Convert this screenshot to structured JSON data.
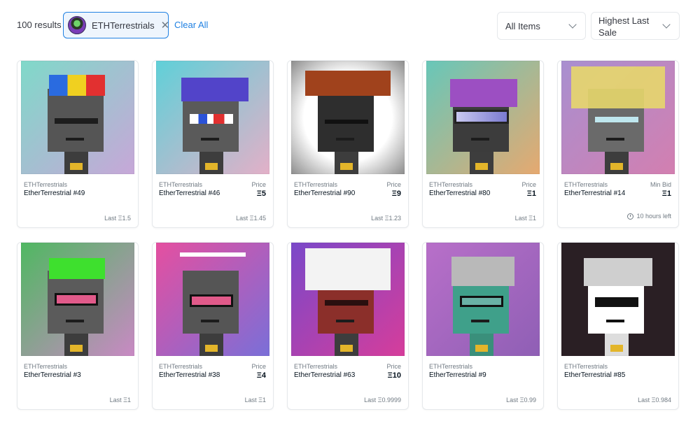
{
  "toolbar": {
    "results": "100 results",
    "filter_chip": "ETHTerrestrials",
    "clear_all": "Clear All",
    "items_dropdown": "All Items",
    "sort_dropdown": "Highest Last Sale"
  },
  "cards": [
    {
      "collection": "ETHTerrestrials",
      "name": "EtherTerrestrial #49",
      "price_label": "",
      "price": "",
      "last_sale": "Last Ξ1.5",
      "bg": "#7fd9c9",
      "bg2": "#c7a7d8",
      "hat": "propeller"
    },
    {
      "collection": "ETHTerrestrials",
      "name": "EtherTerrestrial #46",
      "price_label": "Price",
      "price": "Ξ5",
      "last_sale": "Last Ξ1.45",
      "bg": "#5fd0d8",
      "bg2": "#e3b0c8",
      "hat": "cap"
    },
    {
      "collection": "ETHTerrestrials",
      "name": "EtherTerrestrial #90",
      "price_label": "Price",
      "price": "Ξ9",
      "last_sale": "Last Ξ1.23",
      "bg": "#ffffff",
      "bg2": "#8c8c8c",
      "hat": "cowboy"
    },
    {
      "collection": "ETHTerrestrials",
      "name": "EtherTerrestrial #80",
      "price_label": "Price",
      "price": "Ξ1",
      "last_sale": "Last Ξ1",
      "bg": "#67c7b9",
      "bg2": "#e6a970",
      "hat": "visor"
    },
    {
      "collection": "ETHTerrestrials",
      "name": "EtherTerrestrial #14",
      "price_label": "Min Bid",
      "price": "Ξ1",
      "last_sale": "",
      "time_left": "10 hours left",
      "bg": "#a88fd0",
      "bg2": "#d37fb0",
      "hat": "hair"
    },
    {
      "collection": "ETHTerrestrials",
      "name": "EtherTerrestrial #3",
      "price_label": "",
      "price": "",
      "last_sale": "Last Ξ1",
      "bg": "#4fb861",
      "bg2": "#c989c4",
      "hat": "slime"
    },
    {
      "collection": "ETHTerrestrials",
      "name": "EtherTerrestrial #38",
      "price_label": "Price",
      "price": "Ξ4",
      "last_sale": "Last Ξ1",
      "bg": "#e54fa0",
      "bg2": "#7a6fd8",
      "hat": "antenna"
    },
    {
      "collection": "ETHTerrestrials",
      "name": "EtherTerrestrial #63",
      "price_label": "Price",
      "price": "Ξ10",
      "last_sale": "Last Ξ0.9999",
      "bg": "#7a48c9",
      "bg2": "#d63d9b",
      "hat": "whitehair"
    },
    {
      "collection": "ETHTerrestrials",
      "name": "EtherTerrestrial #9",
      "price_label": "",
      "price": "",
      "last_sale": "Last Ξ0.99",
      "bg": "#b86fc9",
      "bg2": "#8f5fb5",
      "hat": "helmet"
    },
    {
      "collection": "ETHTerrestrials",
      "name": "EtherTerrestrial #85",
      "price_label": "",
      "price": "",
      "last_sale": "Last Ξ0.984",
      "bg": "#2a1f24",
      "bg2": "#1a1418",
      "hat": "skull"
    }
  ]
}
